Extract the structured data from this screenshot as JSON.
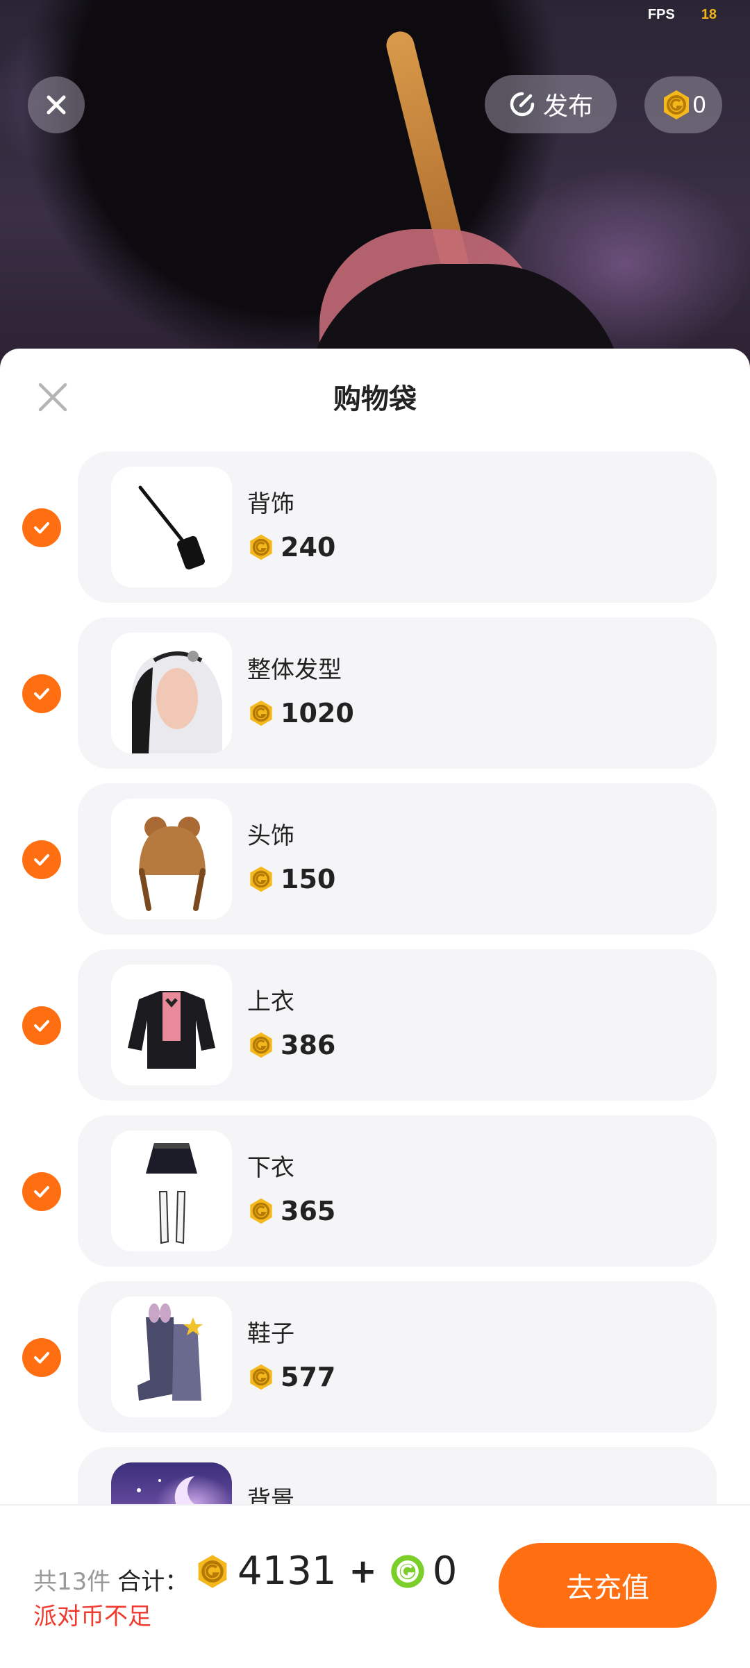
{
  "status": {
    "fps_label": "FPS",
    "fps_value": "18"
  },
  "top_bar": {
    "publish_label": "发布",
    "coin_balance": "0"
  },
  "sheet": {
    "title": "购物袋",
    "items": [
      {
        "name": "背饰",
        "price": "240",
        "checked": true,
        "thumb_icon": "bag-accessory-icon"
      },
      {
        "name": "整体发型",
        "price": "1020",
        "checked": true,
        "thumb_icon": "hairstyle-icon"
      },
      {
        "name": "头饰",
        "price": "150",
        "checked": true,
        "thumb_icon": "hat-icon"
      },
      {
        "name": "上衣",
        "price": "386",
        "checked": true,
        "thumb_icon": "jacket-icon"
      },
      {
        "name": "下衣",
        "price": "365",
        "checked": true,
        "thumb_icon": "skirt-icon"
      },
      {
        "name": "鞋子",
        "price": "577",
        "checked": true,
        "thumb_icon": "boots-icon"
      },
      {
        "name": "背景",
        "price": "",
        "checked": true,
        "thumb_icon": "background-scene-icon"
      }
    ]
  },
  "footer": {
    "count": "共13件",
    "total_label": "合计：",
    "total_coins": "4131",
    "plus": "+",
    "green_coins": "0",
    "warning": "派对币不足",
    "recharge_label": "去充值"
  },
  "colors": {
    "accent": "#ff6f12",
    "coin_gold": "#f5b81c",
    "coin_green": "#7ccf2a",
    "warning": "#ef3b2d"
  }
}
